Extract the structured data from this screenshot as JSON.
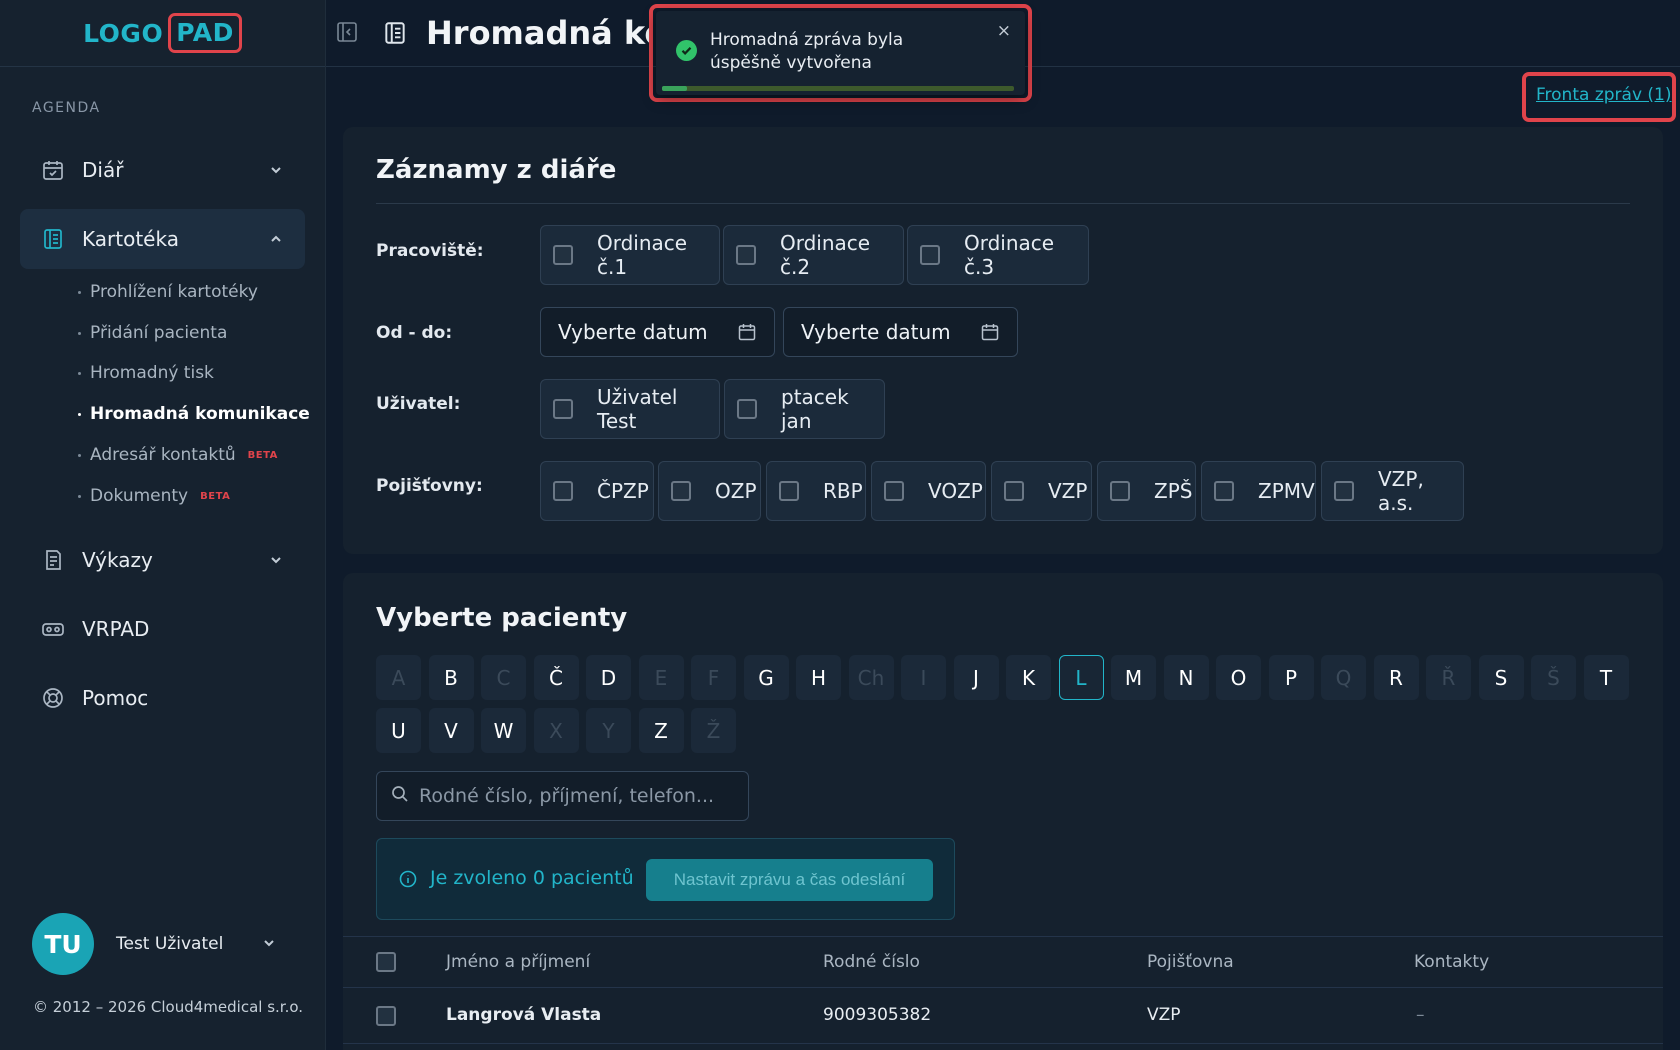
{
  "logo": {
    "part1": "LOGO",
    "part2": "PAD"
  },
  "sidebar": {
    "section_title": "AGENDA",
    "items": [
      {
        "label": "Diář"
      },
      {
        "label": "Kartotéka"
      },
      {
        "label": "Výkazy"
      },
      {
        "label": "VRPAD"
      },
      {
        "label": "Pomoc"
      }
    ],
    "subitems": [
      {
        "label": "Prohlížení kartotéky"
      },
      {
        "label": "Přidání pacienta"
      },
      {
        "label": "Hromadný tisk"
      },
      {
        "label": "Hromadná komunikace"
      },
      {
        "label": "Adresář kontaktů",
        "badge": "BETA"
      },
      {
        "label": "Dokumenty",
        "badge": "BETA"
      }
    ],
    "user": {
      "initials": "TU",
      "name": "Test Uživatel"
    },
    "copyright": "© 2012 – 2026 Cloud4medical s.r.o."
  },
  "header": {
    "title": "Hromadná komunikace"
  },
  "toast": {
    "message": "Hromadná zpráva byla úspěšně vytvořena",
    "close": "×",
    "progress": 0.07
  },
  "queue_link": "Fronta zpráv (1)",
  "diary_card": {
    "title": "Záznamy z diáře",
    "workplace_label": "Pracoviště:",
    "workplaces": [
      "Ordinace č.1",
      "Ordinace č.2",
      "Ordinace č.3"
    ],
    "date_label": "Od - do:",
    "date_from_placeholder": "Vyberte datum",
    "date_to_placeholder": "Vyberte datum",
    "user_label": "Uživatel:",
    "users": [
      "Uživatel Test",
      "ptacek jan"
    ],
    "insurer_label": "Pojišťovny:",
    "insurers": [
      "ČPZP",
      "OZP",
      "RBP",
      "VOZP",
      "VZP",
      "ZPŠ",
      "ZPMV",
      "VZP, a.s."
    ]
  },
  "patients_card": {
    "title": "Vyberte pacienty",
    "letters": [
      {
        "l": "A",
        "disabled": true
      },
      {
        "l": "B"
      },
      {
        "l": "C",
        "disabled": true
      },
      {
        "l": "Č"
      },
      {
        "l": "D"
      },
      {
        "l": "E",
        "disabled": true
      },
      {
        "l": "F",
        "disabled": true
      },
      {
        "l": "G"
      },
      {
        "l": "H"
      },
      {
        "l": "Ch",
        "disabled": true
      },
      {
        "l": "I",
        "disabled": true
      },
      {
        "l": "J"
      },
      {
        "l": "K"
      },
      {
        "l": "L",
        "selected": true
      },
      {
        "l": "M"
      },
      {
        "l": "N"
      },
      {
        "l": "O"
      },
      {
        "l": "P"
      },
      {
        "l": "Q",
        "disabled": true
      },
      {
        "l": "R"
      },
      {
        "l": "Ř",
        "disabled": true
      },
      {
        "l": "S"
      },
      {
        "l": "Š",
        "disabled": true
      },
      {
        "l": "T"
      },
      {
        "l": "U"
      },
      {
        "l": "V"
      },
      {
        "l": "W"
      },
      {
        "l": "X",
        "disabled": true
      },
      {
        "l": "Y",
        "disabled": true
      },
      {
        "l": "Z"
      },
      {
        "l": "Ž",
        "disabled": true
      }
    ],
    "search_placeholder": "Rodné číslo, příjmení, telefon...",
    "selected_info": "Je zvoleno 0 pacientů",
    "set_message_button": "Nastavit zprávu a čas odeslání",
    "table": {
      "columns": [
        "Jméno a příjmení",
        "Rodné číslo",
        "Pojišťovna",
        "Kontakty"
      ],
      "rows": [
        {
          "name": "Langrová Vlasta",
          "birth_number": "9009305382",
          "insurer": "VZP",
          "contacts": "–"
        }
      ]
    }
  },
  "colors": {
    "accent": "#22b5c9",
    "highlight": "#e0444b",
    "background": "#0f1b2b",
    "success": "#31c36a"
  }
}
